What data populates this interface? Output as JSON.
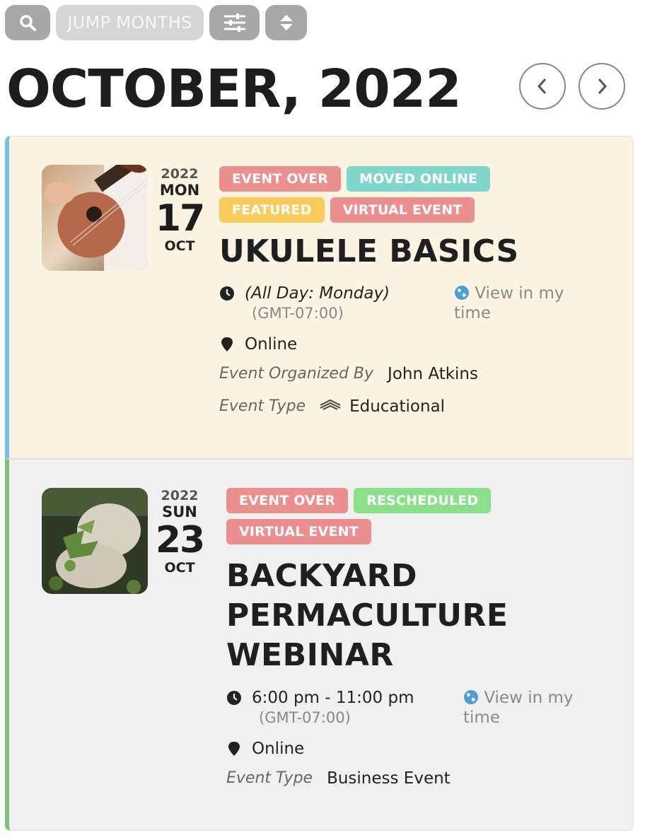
{
  "toolbar": {
    "search_icon": "search-icon",
    "jump_months_label": "JUMP MONTHS",
    "filter_icon": "sliders-icon",
    "sort_icon": "sort-icon"
  },
  "header": {
    "month_title": "OCTOBER, 2022",
    "prev_icon": "chevron-left-icon",
    "next_icon": "chevron-right-icon"
  },
  "events": [
    {
      "year": "2022",
      "weekday": "MON",
      "day": "17",
      "month": "OCT",
      "tags": [
        {
          "label": "EVENT OVER",
          "color": "#ec8f8f"
        },
        {
          "label": "MOVED ONLINE",
          "color": "#7fd6cb"
        },
        {
          "label": "FEATURED",
          "color": "#f9cc5c"
        },
        {
          "label": "VIRTUAL EVENT",
          "color": "#ec8f8f"
        }
      ],
      "title": "UKULELE BASICS",
      "time": "(All Day: Monday)",
      "timezone": "(GMT-07:00)",
      "view_time_line1": "View in my",
      "view_time_line2": "time",
      "location": "Online",
      "organized_by_label": "Event Organized By",
      "organizer": "John Atkins",
      "event_type_label": "Event Type",
      "event_type": "Educational",
      "accent_color": "#74c0e6"
    },
    {
      "year": "2022",
      "weekday": "SUN",
      "day": "23",
      "month": "OCT",
      "tags": [
        {
          "label": "EVENT OVER",
          "color": "#ec8f8f"
        },
        {
          "label": "RESCHEDULED",
          "color": "#8be08b"
        },
        {
          "label": "VIRTUAL EVENT",
          "color": "#ec8f8f"
        }
      ],
      "title_lines": [
        "BACKYARD",
        "PERMACULTURE",
        "WEBINAR"
      ],
      "time": "6:00 pm - 11:00 pm",
      "timezone": "(GMT-07:00)",
      "view_time_line1": "View in my",
      "view_time_line2": "time",
      "location": "Online",
      "event_type_label": "Event Type",
      "event_type": "Business Event",
      "accent_color": "#7dc27d"
    }
  ]
}
